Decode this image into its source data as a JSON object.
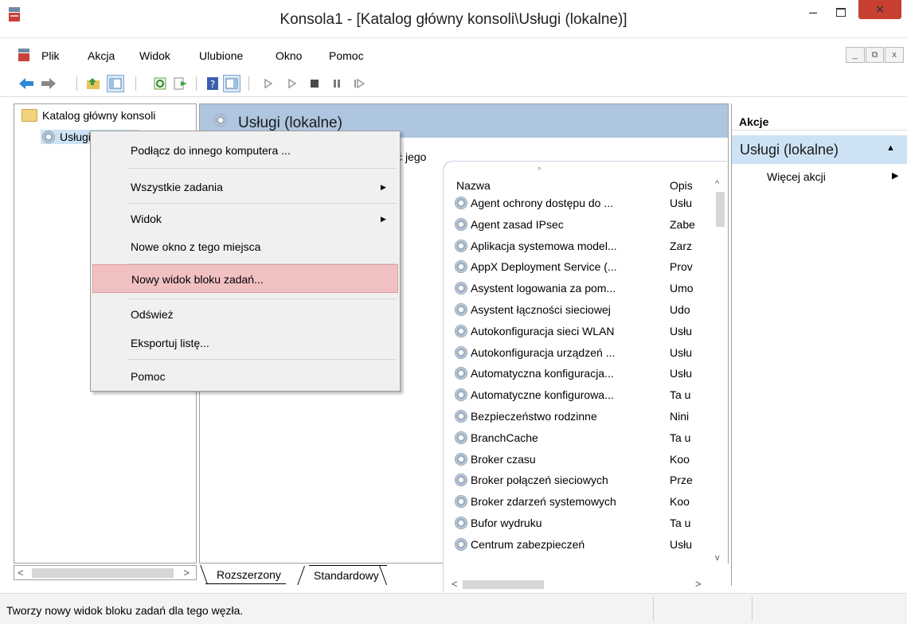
{
  "window": {
    "title": "Konsola1 - [Katalog główny konsoli\\Usługi (lokalne)]",
    "minimize_glyph": "–",
    "close_glyph": "✕"
  },
  "menubar": {
    "items": [
      "Plik",
      "Akcja",
      "Widok",
      "Ulubione",
      "Okno",
      "Pomoc"
    ],
    "mdi_buttons": [
      "_",
      "⧉",
      "x"
    ]
  },
  "toolbar": {
    "buttons": [
      "back-arrow-icon",
      "forward-arrow-icon",
      "up-folder-icon",
      "show-hide-tree-icon",
      "refresh-icon",
      "export-list-icon",
      "help-icon",
      "show-hide-action-pane-icon",
      "start-service-icon",
      "start-service-alt-icon",
      "stop-service-icon",
      "pause-service-icon",
      "resume-service-icon"
    ]
  },
  "tree": {
    "root": "Katalog główny konsoli",
    "child": "Usługi (lokalne)"
  },
  "main": {
    "header_title": "Usługi (lokalne)",
    "description_fragment": "ić jego",
    "columns": {
      "name": "Nazwa",
      "desc": "Opis"
    },
    "sort_glyph": "^",
    "rows": [
      {
        "name": "Agent ochrony dostępu do ...",
        "desc": "Usłu"
      },
      {
        "name": "Agent zasad IPsec",
        "desc": "Zabe"
      },
      {
        "name": "Aplikacja systemowa model...",
        "desc": "Zarz"
      },
      {
        "name": "AppX Deployment Service (...",
        "desc": "Prov"
      },
      {
        "name": "Asystent logowania za pom...",
        "desc": "Umo"
      },
      {
        "name": "Asystent łączności sieciowej",
        "desc": "Udo"
      },
      {
        "name": "Autokonfiguracja sieci WLAN",
        "desc": "Usłu"
      },
      {
        "name": "Autokonfiguracja urządzeń ...",
        "desc": "Usłu"
      },
      {
        "name": "Automatyczna konfiguracja...",
        "desc": "Usłu"
      },
      {
        "name": "Automatyczne konfigurowa...",
        "desc": "Ta u"
      },
      {
        "name": "Bezpieczeństwo rodzinne",
        "desc": "Nini"
      },
      {
        "name": "BranchCache",
        "desc": "Ta u"
      },
      {
        "name": "Broker czasu",
        "desc": "Koo"
      },
      {
        "name": "Broker połączeń sieciowych",
        "desc": "Prze"
      },
      {
        "name": "Broker zdarzeń systemowych",
        "desc": "Koo"
      },
      {
        "name": "Bufor wydruku",
        "desc": "Ta u"
      },
      {
        "name": "Centrum zabezpieczeń",
        "desc": "Usłu"
      }
    ],
    "tabs": [
      "Rozszerzony",
      "Standardowy"
    ]
  },
  "actions": {
    "title": "Akcje",
    "section": "Usługi (lokalne)",
    "more": "Więcej akcji"
  },
  "context_menu": {
    "items": [
      {
        "label": "Podłącz do innego komputera ..."
      },
      {
        "label": "Wszystkie zadania",
        "submenu": true
      },
      {
        "label": "Widok",
        "submenu": true
      },
      {
        "label": "Nowe okno z tego miejsca"
      },
      {
        "label": "Nowy widok bloku zadań...",
        "highlighted": true
      },
      {
        "label": "Odśwież"
      },
      {
        "label": "Eksportuj listę..."
      },
      {
        "label": "Pomoc"
      }
    ]
  },
  "statusbar": {
    "text": "Tworzy nowy widok bloku zadań dla tego węzła."
  },
  "colors": {
    "header_bg": "#aec6df",
    "selection_bg": "#cde3f5",
    "menu_highlight": "#f1c1c2",
    "close_button": "#c84031"
  }
}
